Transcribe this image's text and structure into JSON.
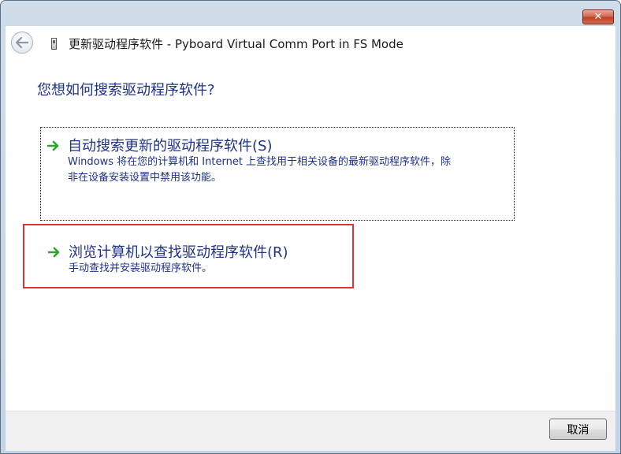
{
  "window": {
    "title": "更新驱动程序软件 - Pyboard Virtual Comm Port in FS Mode",
    "close_label": "✕"
  },
  "content": {
    "question": "您想如何搜索驱动程序软件?",
    "options": [
      {
        "title": "自动搜索更新的驱动程序软件(S)",
        "description_line1": "Windows 将在您的计算机和 Internet 上查找用于相关设备的最新驱动程序软件，除",
        "description_line2": "非在设备安装设置中禁用该功能。"
      },
      {
        "title": "浏览计算机以查找驱动程序软件(R)",
        "description_line1": "手动查找并安装驱动程序软件。"
      }
    ]
  },
  "footer": {
    "cancel_label": "取消"
  },
  "colors": {
    "text_blue": "#1e3287",
    "arrow_green": "#2fa32f",
    "highlight_red": "#e03434"
  }
}
